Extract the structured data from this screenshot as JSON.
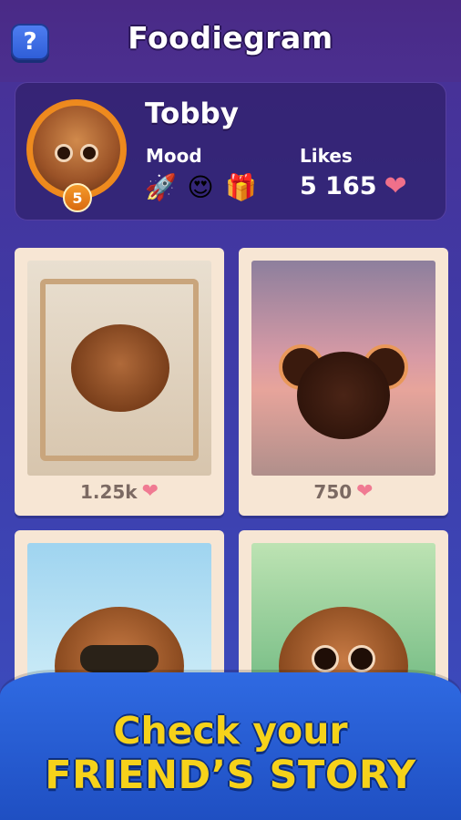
{
  "header": {
    "help_label": "?",
    "title": "Foodiegram"
  },
  "profile": {
    "name": "Tobby",
    "level": "5",
    "mood_label": "Mood",
    "mood_icons": [
      "rocket-icon",
      "heart-eyes-emoji",
      "gift-icon"
    ],
    "mood_glyphs": [
      "🚀",
      "😍",
      "🎁"
    ],
    "likes_label": "Likes",
    "likes_value": "5 165",
    "heart_glyph": "❤"
  },
  "photos": [
    {
      "likes": "1.25k",
      "subject": "sleeping-in-crib"
    },
    {
      "likes": "750",
      "subject": "sunset-beach"
    },
    {
      "likes": "",
      "subject": "flamingo-sunglasses"
    },
    {
      "likes": "",
      "subject": "eating-watermelon"
    }
  ],
  "banner": {
    "line1": "Check your",
    "line2": "FRIEND’S STORY"
  },
  "colors": {
    "background": "#3f3aa6",
    "accent_orange": "#e97a15",
    "banner_blue": "#2f6ae2",
    "banner_text": "#f6d21a",
    "heart": "#f07a92"
  }
}
